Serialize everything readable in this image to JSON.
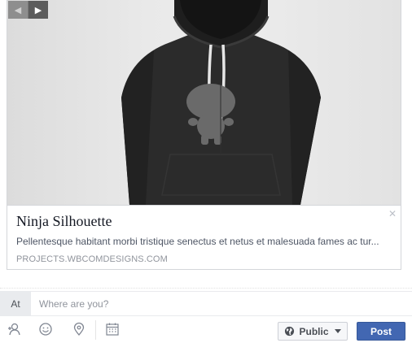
{
  "link_preview": {
    "title": "Ninja Silhouette",
    "description": "Pellentesque habitant morbi tristique senectus et netus et malesuada fames ac tur...",
    "domain": "PROJECTS.WBCOMDESIGNS.COM",
    "close_glyph": "✕"
  },
  "carousel": {
    "prev_glyph": "◀",
    "next_glyph": "▶"
  },
  "location": {
    "label": "At",
    "placeholder": "Where are you?",
    "value": ""
  },
  "toolbar": {
    "icons": [
      "tag-friends-icon",
      "feeling-icon",
      "location-pin-icon",
      "calendar-icon"
    ],
    "audience_label": "Public",
    "post_label": "Post"
  },
  "colors": {
    "accent": "#4267b2",
    "hoodie": "#2a2a2a"
  }
}
